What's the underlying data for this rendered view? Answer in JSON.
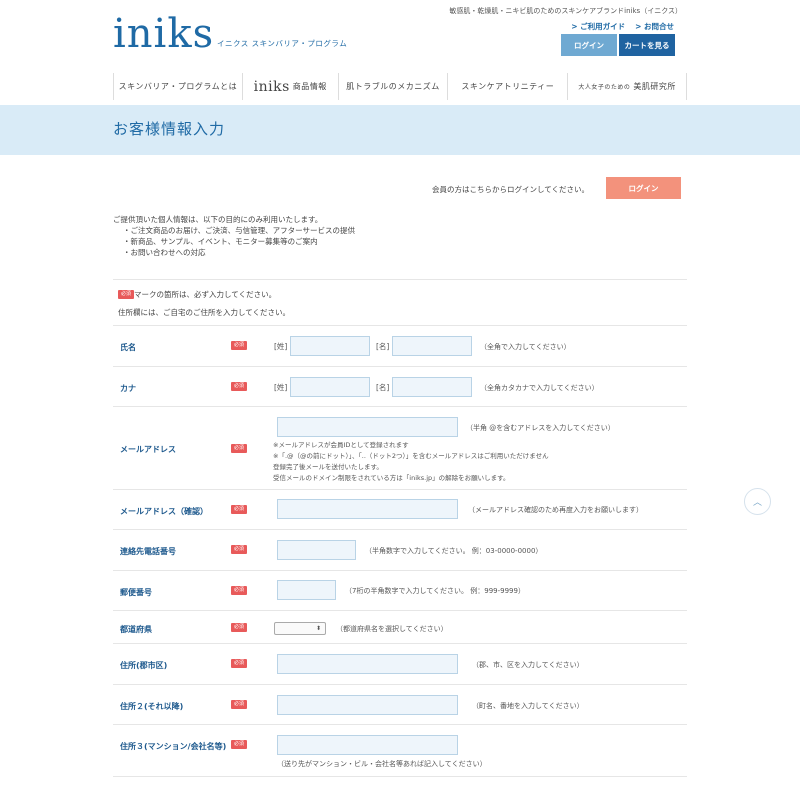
{
  "header": {
    "logo": "iniks",
    "logo_sub": "イニクス スキンバリア・プログラム",
    "tagline": "敏感肌・乾燥肌・ニキビ肌のためのスキンケアブランドiniks（イニクス）",
    "guide_label": "ご利用ガイド",
    "contact_label": "お問合せ",
    "login_button": "ログイン",
    "cart_button": "カートを見る"
  },
  "nav": {
    "item1": "スキンバリア・プログラムとは",
    "item2_brand": "iniks",
    "item2": "商品情報",
    "item3": "肌トラブルのメカニズム",
    "item4": "スキンケアトリニティー",
    "item5_small": "大人女子のための",
    "item5": "美肌研究所"
  },
  "page": {
    "title": "お客様情報入力",
    "member_text": "会員の方はこちらからログインしてください。",
    "member_login": "ログイン"
  },
  "notice": {
    "intro": "ご提供頂いた個人情報は、以下の目的にのみ利用いたします。",
    "items": [
      "ご注文商品のお届け、ご決済、与信管理、アフターサービスの提供",
      "新商品、サンプル、イベント、モニター募集等のご案内",
      "お問い合わせへの対応"
    ]
  },
  "required": {
    "badge": "必須",
    "note": "マークの箇所は、必ず入力してください。",
    "address_note": "住所欄には、ご自宅のご住所を入力してください。"
  },
  "form": {
    "name": {
      "label": "氏名",
      "sei": "[姓]",
      "mei": "[名]",
      "hint": "（全角で入力してください）"
    },
    "kana": {
      "label": "カナ",
      "sei": "[姓]",
      "mei": "[名]",
      "hint": "（全角カタカナで入力してください）"
    },
    "email": {
      "label": "メールアドレス",
      "hint": "（半角 @を含むアドレスを入力してください）",
      "notes": [
        "※メールアドレスが会員IDとして登録されます",
        "※「.@（@の前にドット）」、「..（ドット2つ）」を含むメールアドレスはご利用いただけません",
        "登録完了後メールを送付いたします。",
        "受信メールのドメイン制限をされている方は「iniks.jp」の解除をお願いします。"
      ]
    },
    "email_confirm": {
      "label": "メールアドレス（確認）",
      "hint": "（メールアドレス確認のため再度入力をお願いします）"
    },
    "phone": {
      "label": "連絡先電話番号",
      "hint": "（半角数字で入力してください。 例：03-0000-0000）"
    },
    "zip": {
      "label": "郵便番号",
      "hint": "（7桁の半角数字で入力してください。 例：999-9999）"
    },
    "pref": {
      "label": "都道府県",
      "select": "⬍",
      "hint": "（都道府県名を選択してください）"
    },
    "addr1": {
      "label": "住所(郡市区)",
      "hint": "（郡、市、区を入力してください）"
    },
    "addr2": {
      "label": "住所２(それ以降)",
      "hint": "（町名、番地を入力してください）"
    },
    "addr3": {
      "label": "住所３(マンション/会社名等)",
      "hint": "（送り先がマンション・ビル・会社名等あれば記入してください）"
    }
  },
  "icons": {
    "scroll_top": "chevron-up-icon"
  }
}
